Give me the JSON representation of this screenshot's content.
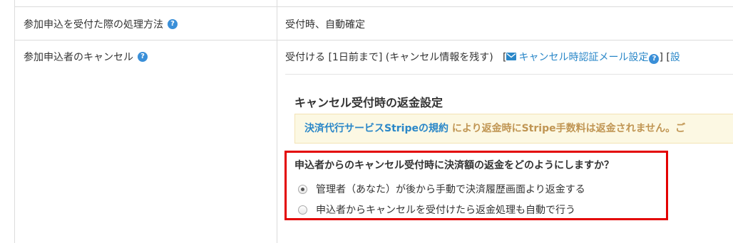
{
  "rows": [
    {
      "label": "参加申込を受付た際の処理方法",
      "value": "受付時、自動確定"
    },
    {
      "label": "参加申込者のキャンセル",
      "value_prefix": "受付ける [1日前まで] (キャンセル情報を残す)   [",
      "value_link": "キャンセル時認証メール設定",
      "value_suffix": "] [",
      "value_tail": "設"
    }
  ],
  "refund": {
    "title": "キャンセル受付時の返金設定",
    "notice_link": "決済代行サービスStripeの規約",
    "notice_text": "により返金時にStripe手数料は返金されません。ご",
    "question": "申込者からのキャンセル受付時に決済額の返金をどのようにしますか？",
    "options": [
      {
        "label": "管理者（あなた）が後から手動で決済履歴画面より返金する",
        "selected": true
      },
      {
        "label": "申込者からキャンセルを受付けたら返金処理も自動で行う",
        "selected": false
      }
    ]
  },
  "colors": {
    "accent": "#2a87c8",
    "highlight_box": "#e30000",
    "notice_bg": "#fcf8e3",
    "notice_text": "#c09553"
  },
  "icons": [
    "help-icon",
    "mail-icon",
    "radio-selected",
    "radio-unselected"
  ]
}
